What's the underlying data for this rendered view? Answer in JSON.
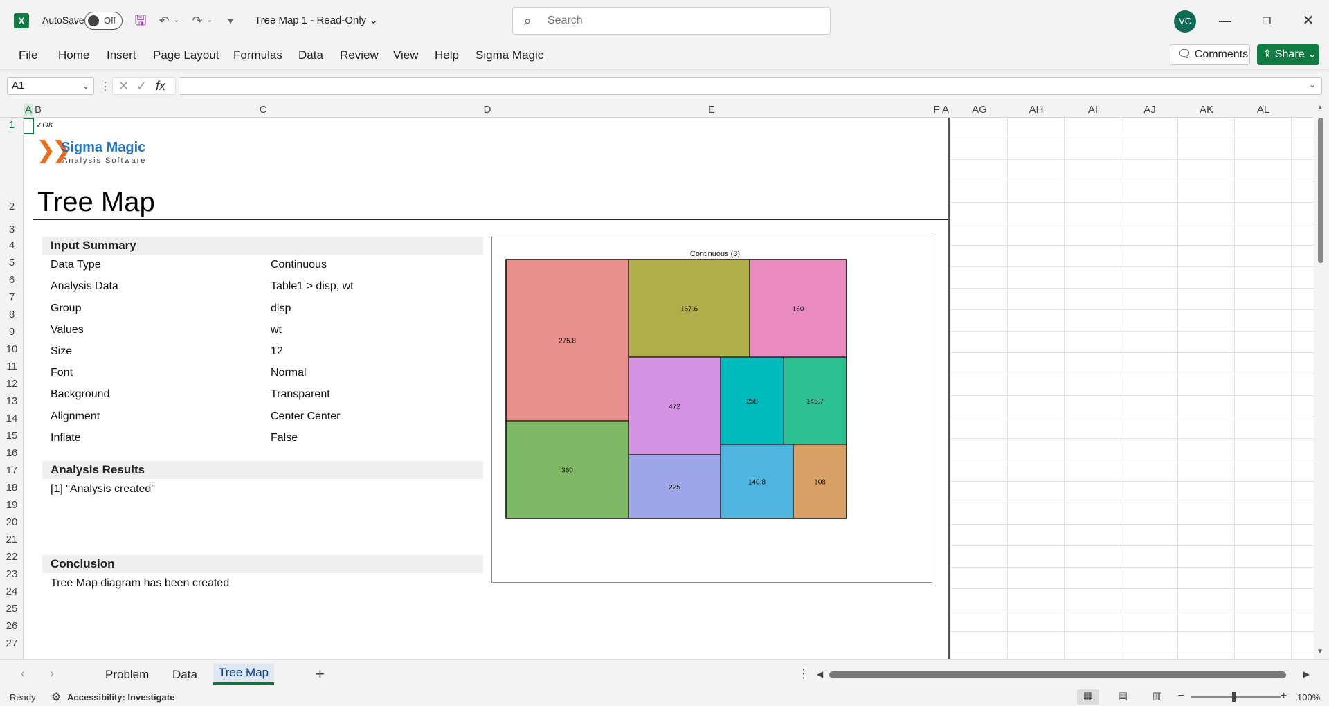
{
  "titlebar": {
    "autosave_label": "AutoSave",
    "autosave_state": "Off",
    "doc_title": "Tree Map 1  -  Read-Only",
    "search_placeholder": "Search",
    "avatar_initials": "VC"
  },
  "ribbon": {
    "tabs": [
      "File",
      "Home",
      "Insert",
      "Page Layout",
      "Formulas",
      "Data",
      "Review",
      "View",
      "Help",
      "Sigma Magic"
    ],
    "comments_label": "Comments",
    "share_label": "Share"
  },
  "formula_bar": {
    "name_box": "A1",
    "fx": "fx",
    "value": ""
  },
  "grid": {
    "columns": [
      "A",
      "B",
      "C",
      "D",
      "E",
      "F",
      "A",
      "AG",
      "AH",
      "AI",
      "AJ",
      "AK",
      "AL"
    ],
    "rows": [
      "1",
      "2",
      "3",
      "4",
      "5",
      "6",
      "7",
      "8",
      "9",
      "10",
      "11",
      "12",
      "13",
      "14",
      "15",
      "16",
      "17",
      "18",
      "19",
      "20",
      "21",
      "22",
      "23",
      "24",
      "25",
      "26",
      "27"
    ]
  },
  "sheet": {
    "ok_text": "✓OK",
    "logo": {
      "name": "Sigma Magic",
      "tagline": "Analysis Software"
    },
    "title": "Tree Map",
    "input_summary": {
      "header": "Input Summary",
      "rows": [
        {
          "key": "Data Type",
          "value": "Continuous"
        },
        {
          "key": "Analysis Data",
          "value": "Table1 > disp, wt"
        },
        {
          "key": "Group",
          "value": "disp"
        },
        {
          "key": "Values",
          "value": "wt"
        },
        {
          "key": "Size",
          "value": "12"
        },
        {
          "key": "Font",
          "value": "Normal"
        },
        {
          "key": "Background",
          "value": "Transparent"
        },
        {
          "key": "Alignment",
          "value": "Center Center"
        },
        {
          "key": "Inflate",
          "value": "False"
        }
      ]
    },
    "analysis_results": {
      "header": "Analysis Results",
      "text": "[1] \"Analysis created\""
    },
    "conclusion": {
      "header": "Conclusion",
      "text": "Tree Map diagram has been created"
    }
  },
  "chart_data": {
    "type": "treemap",
    "title": "Continuous (3)",
    "tiles": [
      {
        "label": "275.8",
        "color": "#e8908c"
      },
      {
        "label": "360",
        "color": "#7fb965"
      },
      {
        "label": "167.6",
        "color": "#afae4a"
      },
      {
        "label": "160",
        "color": "#ea8bc0"
      },
      {
        "label": "472",
        "color": "#d592e2"
      },
      {
        "label": "225",
        "color": "#9ea6ea"
      },
      {
        "label": "258",
        "color": "#00bcbd"
      },
      {
        "label": "146.7",
        "color": "#2cc091"
      },
      {
        "label": "140.8",
        "color": "#4fb5de"
      },
      {
        "label": "108",
        "color": "#d9a065"
      }
    ]
  },
  "sheet_tabs": {
    "tabs": [
      "Problem",
      "Data",
      "Tree Map"
    ],
    "active": "Tree Map"
  },
  "status": {
    "ready": "Ready",
    "accessibility": "Accessibility: Investigate",
    "zoom": "100%"
  }
}
